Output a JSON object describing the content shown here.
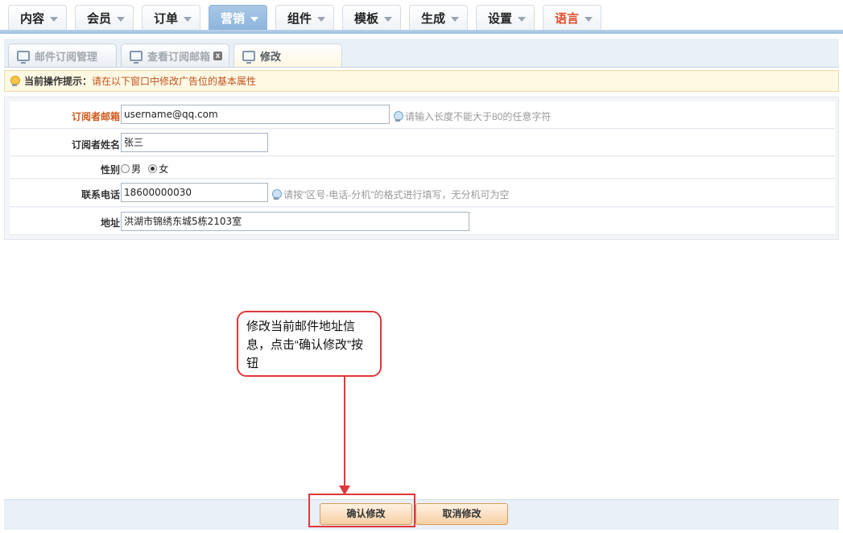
{
  "nav": {
    "items": [
      {
        "label": "内容"
      },
      {
        "label": "会员"
      },
      {
        "label": "订单"
      },
      {
        "label": "营销"
      },
      {
        "label": "组件"
      },
      {
        "label": "模板"
      },
      {
        "label": "生成"
      },
      {
        "label": "设置"
      },
      {
        "label": "语言"
      }
    ],
    "active": "营销"
  },
  "subtabs": [
    {
      "label": "邮件订阅管理"
    },
    {
      "label": "查看订阅邮箱",
      "close": "x"
    },
    {
      "label": "修改"
    }
  ],
  "hint": {
    "label": "当前操作提示：",
    "message": "请在以下窗口中修改广告位的基本属性"
  },
  "form": {
    "email": {
      "label": "订阅者邮箱",
      "value": "username@qq.com",
      "tip": "请输入长度不能大于80的任意字符"
    },
    "name": {
      "label": "订阅者姓名",
      "value": "张三"
    },
    "gender": {
      "label": "性别",
      "options": [
        "男",
        "女"
      ],
      "selected": "女"
    },
    "phone": {
      "label": "联系电话",
      "value": "18600000030",
      "tip": "请按\"区号-电话-分机\"的格式进行填写，无分机可为空"
    },
    "address": {
      "label": "地址",
      "value": "洪湖市锦绣东城5栋2103室"
    }
  },
  "annotation": {
    "text": "修改当前邮件地址信息，点击“确认修改”按钮"
  },
  "buttons": {
    "confirm": "确认修改",
    "cancel": "取消修改"
  },
  "colors": {
    "accent": "#8db4dc",
    "warning_text": "#c0531f",
    "annotation_red": "#e0383b"
  }
}
